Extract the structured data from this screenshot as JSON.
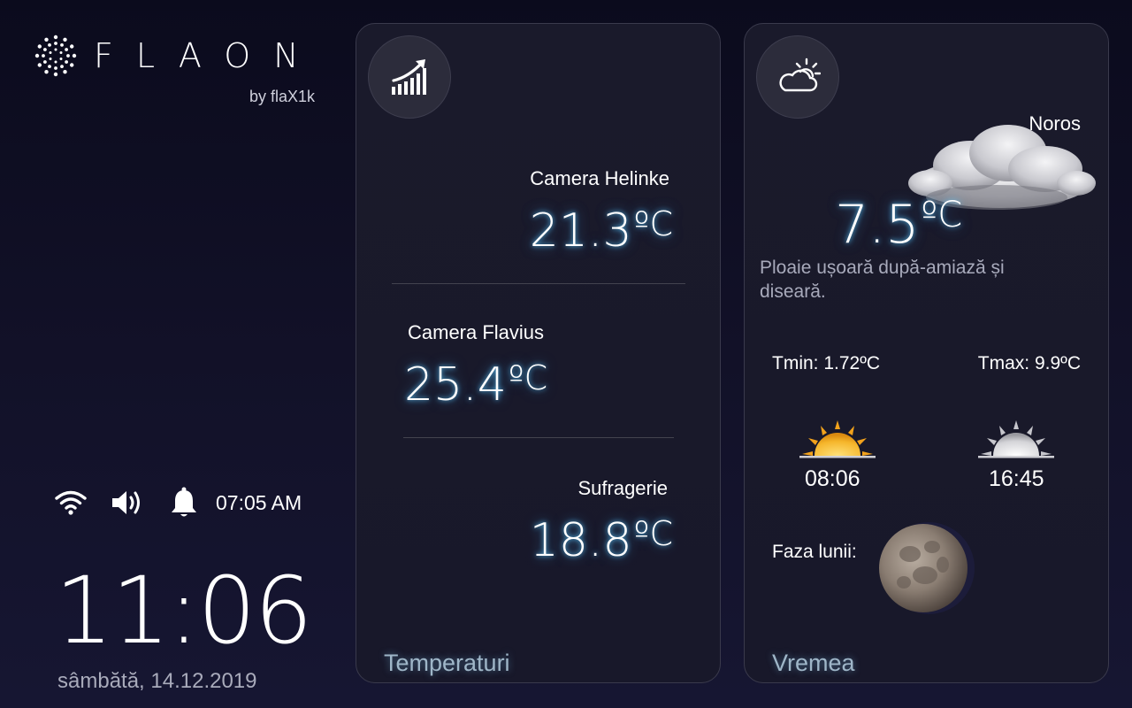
{
  "brand": {
    "name": "FLAON",
    "byline": "by flaX1k"
  },
  "status": {
    "wifi_icon": "wifi-icon",
    "volume_icon": "volume-icon",
    "alarm_icon": "bell-icon",
    "alarm_time": "07:05 AM"
  },
  "clock": {
    "time": "11:06",
    "date": "sâmbătă, 14.12.2019"
  },
  "temperatures": {
    "icon": "chart-up-icon",
    "title": "Temperaturi",
    "unit": "ºC",
    "rooms": [
      {
        "name": "Camera Helinke",
        "value": "21.3"
      },
      {
        "name": "Camera Flavius",
        "value": "25.4"
      },
      {
        "name": "Sufragerie",
        "value": "18.8"
      }
    ]
  },
  "weather": {
    "icon": "partly-cloudy-icon",
    "title": "Vremea",
    "condition": "Noros",
    "temperature": "7.5",
    "unit": "ºC",
    "description": "Ploaie ușoară după-amiază și diseară.",
    "tmin": "Tmin: 1.72ºC",
    "tmax": "Tmax: 9.9ºC",
    "sunrise": "08:06",
    "sunset": "16:45",
    "moon_label": "Faza lunii:"
  },
  "colors": {
    "background": "#121128",
    "panel": "#1a1a2b",
    "glow": "#5ac8ff",
    "footer": "#9fb6c8",
    "sun": "#f5b52a"
  }
}
